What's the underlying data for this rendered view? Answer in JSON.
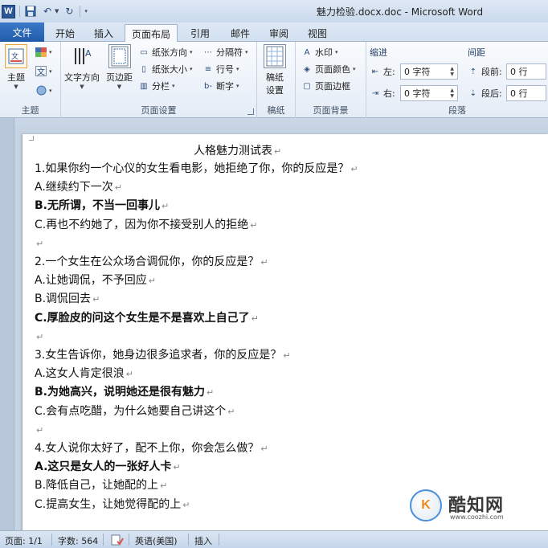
{
  "titlebar": {
    "app_icon_letter": "W",
    "title": "魅力检验.docx.doc - Microsoft Word"
  },
  "tabs": {
    "file": "文件",
    "items": [
      "开始",
      "插入",
      "页面布局",
      "引用",
      "邮件",
      "审阅",
      "视图"
    ],
    "active": "页面布局"
  },
  "ribbon": {
    "theme": {
      "button": "主题",
      "group": "主题"
    },
    "page_setup": {
      "text_direction": "文字方向",
      "margins": "页边距",
      "orientation": "纸张方向",
      "size": "纸张大小",
      "columns": "分栏",
      "breaks": "分隔符",
      "line_numbers": "行号",
      "hyphenation": "断字",
      "group": "页面设置"
    },
    "manuscript": {
      "button_line1": "稿纸",
      "button_line2": "设置",
      "group": "稿纸"
    },
    "page_background": {
      "watermark": "水印",
      "page_color": "页面颜色",
      "page_borders": "页面边框",
      "group": "页面背景"
    },
    "paragraph": {
      "indent_heading": "缩进",
      "spacing_heading": "间距",
      "left_label": "左:",
      "left_value": "0 字符",
      "right_label": "右:",
      "right_value": "0 字符",
      "before_label": "段前:",
      "before_value": "0 行",
      "after_label": "段后:",
      "after_value": "0 行",
      "group": "段落"
    }
  },
  "document": {
    "title": "人格魅力测试表",
    "lines": [
      {
        "text": "1.如果你约一个心仪的女生看电影，她拒绝了你，你的反应是？",
        "bold": false
      },
      {
        "text": "A.继续约下一次",
        "bold": false
      },
      {
        "text": "B.无所谓，不当一回事儿",
        "bold": true
      },
      {
        "text": "C.再也不约她了，因为你不接受别人的拒绝",
        "bold": false
      },
      {
        "text": "",
        "bold": false
      },
      {
        "text": "2.一个女生在公众场合调侃你，你的反应是？",
        "bold": false
      },
      {
        "text": "A.让她调侃，不予回应",
        "bold": false
      },
      {
        "text": "B.调侃回去",
        "bold": false
      },
      {
        "text": "C.厚脸皮的问这个女生是不是喜欢上自己了",
        "bold": true
      },
      {
        "text": "",
        "bold": false
      },
      {
        "text": "3.女生告诉你，她身边很多追求者，你的反应是？",
        "bold": false
      },
      {
        "text": "A.这女人肯定很浪",
        "bold": false
      },
      {
        "text": "B.为她高兴，说明她还是很有魅力",
        "bold": true
      },
      {
        "text": "C.会有点吃醋，为什么她要自己讲这个",
        "bold": false
      },
      {
        "text": "",
        "bold": false
      },
      {
        "text": "4.女人说你太好了，配不上你，你会怎么做？",
        "bold": false
      },
      {
        "text": "A.这只是女人的一张好人卡",
        "bold": true
      },
      {
        "text": "B.降低自己，让她配的上",
        "bold": false
      },
      {
        "text": "C.提高女生，让她觉得配的上",
        "bold": false
      }
    ],
    "paragraph_mark": "↵"
  },
  "watermark": {
    "logo_text": "K",
    "name": "酷知网",
    "url": "www.coozhi.com"
  },
  "statusbar": {
    "page": "页面: 1/1",
    "words": "字数: 564",
    "language": "英语(美国)",
    "mode": "插入"
  },
  "colors": {
    "file_tab": "#2b6cbf",
    "brand": "#2b5797"
  }
}
